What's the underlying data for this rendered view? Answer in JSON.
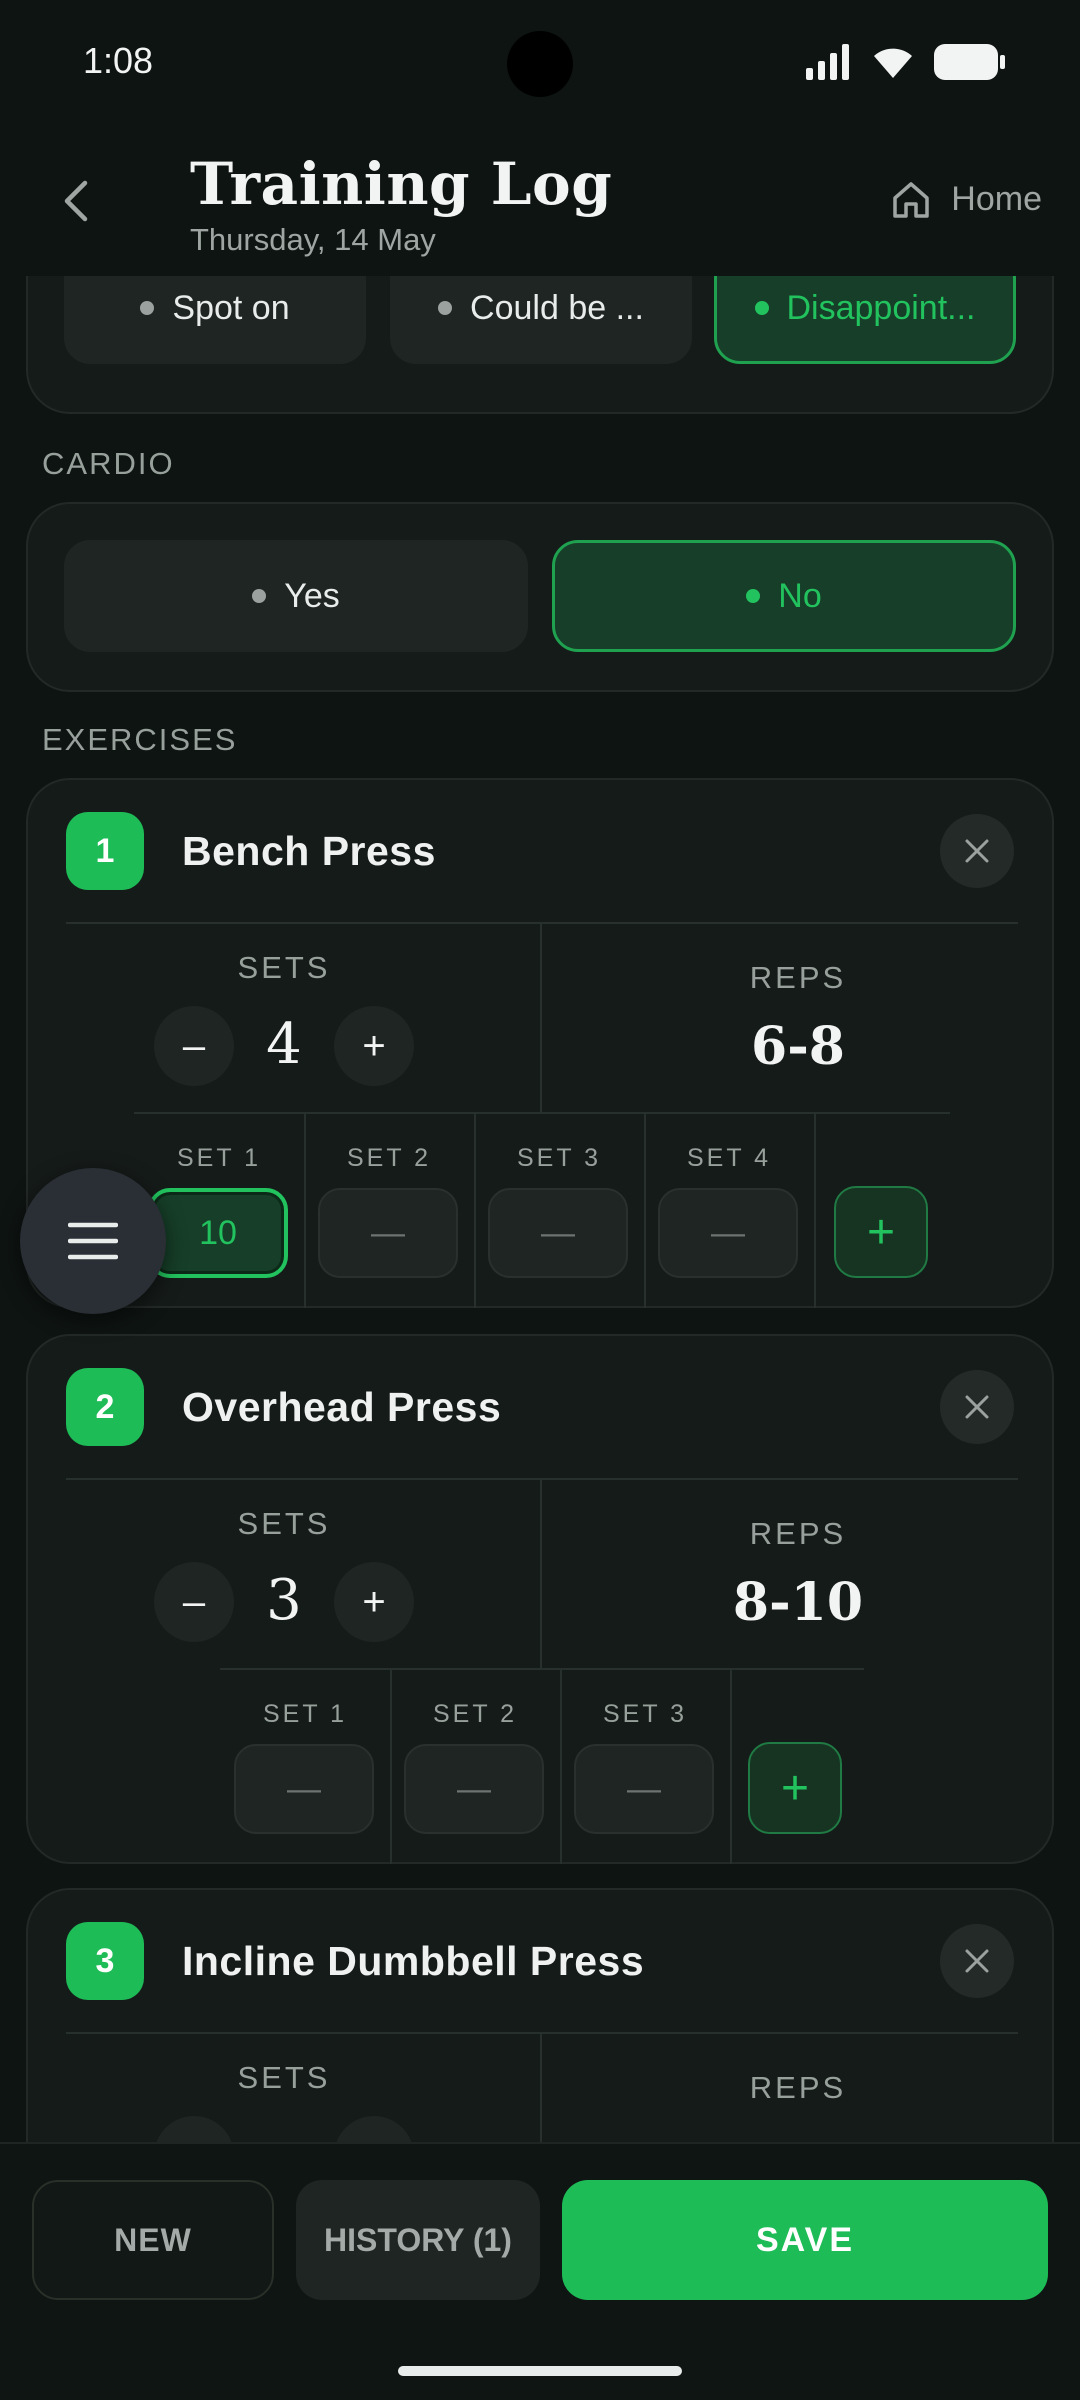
{
  "status_bar": {
    "time": "1:08"
  },
  "header": {
    "title": "Training Log",
    "subtitle": "Thursday, 14 May",
    "home_label": "Home"
  },
  "feeling": {
    "options": [
      {
        "label": "Spot on",
        "selected": false
      },
      {
        "label": "Could be ...",
        "selected": false
      },
      {
        "label": "Disappoint...",
        "selected": true
      }
    ]
  },
  "cardio": {
    "section_label": "CARDIO",
    "options": [
      {
        "label": "Yes",
        "selected": false
      },
      {
        "label": "No",
        "selected": true
      }
    ]
  },
  "exercises_section_label": "EXERCISES",
  "exercise_labels": {
    "sets": "SETS",
    "reps": "REPS",
    "minus": "–",
    "plus": "+",
    "add": "+",
    "empty": "—"
  },
  "exercises": [
    {
      "number": "1",
      "name": "Bench Press",
      "sets": "4",
      "reps": "6-8",
      "set_entries": [
        {
          "label": "SET 1",
          "value": "10"
        },
        {
          "label": "SET 2",
          "value": "—"
        },
        {
          "label": "SET 3",
          "value": "—"
        },
        {
          "label": "SET 4",
          "value": "—"
        }
      ]
    },
    {
      "number": "2",
      "name": "Overhead Press",
      "sets": "3",
      "reps": "8-10",
      "set_entries": [
        {
          "label": "SET 1",
          "value": "—"
        },
        {
          "label": "SET 2",
          "value": "—"
        },
        {
          "label": "SET 3",
          "value": "—"
        }
      ]
    },
    {
      "number": "3",
      "name": "Incline Dumbbell Press",
      "sets": "",
      "reps": ""
    }
  ],
  "bottom_bar": {
    "new_label": "NEW",
    "history_label": "HISTORY (1)",
    "save_label": "SAVE"
  },
  "colors": {
    "accent": "#1ebc57",
    "background": "#0e1412",
    "card": "#151b19"
  }
}
